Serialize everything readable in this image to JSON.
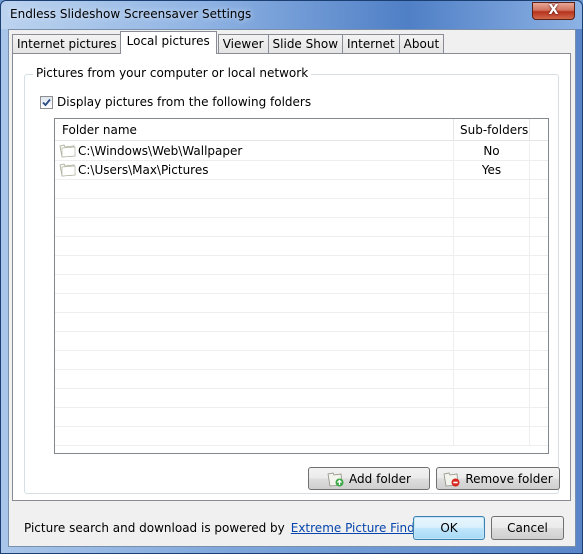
{
  "window": {
    "title": "Endless Slideshow Screensaver Settings",
    "close_glyph": "X"
  },
  "tabs": [
    {
      "label": "Internet pictures",
      "active": false
    },
    {
      "label": "Local pictures",
      "active": true
    },
    {
      "label": "Viewer",
      "active": false
    },
    {
      "label": "Slide Show",
      "active": false
    },
    {
      "label": "Internet",
      "active": false
    },
    {
      "label": "About",
      "active": false
    }
  ],
  "local": {
    "group_title": "Pictures from your computer or local network",
    "display_checkbox": {
      "label": "Display pictures from the following folders",
      "checked": true
    },
    "columns": {
      "folder_name": "Folder name",
      "sub_folders": "Sub-folders"
    },
    "folders": [
      {
        "path": "C:\\Windows\\Web\\Wallpaper",
        "sub_folders": "No",
        "icon": "folder-icon"
      },
      {
        "path": "C:\\Users\\Max\\Pictures",
        "sub_folders": "Yes",
        "icon": "folder-icon"
      }
    ],
    "add_folder_label": "Add folder",
    "remove_folder_label": "Remove folder"
  },
  "footer": {
    "powered_text": "Picture search and download is powered by",
    "link_text": "Extreme Picture Finder",
    "ok_label": "OK",
    "cancel_label": "Cancel"
  },
  "colors": {
    "link": "#0645ad",
    "ok_border": "#3c7fb1",
    "close_red": "#b8321c"
  }
}
